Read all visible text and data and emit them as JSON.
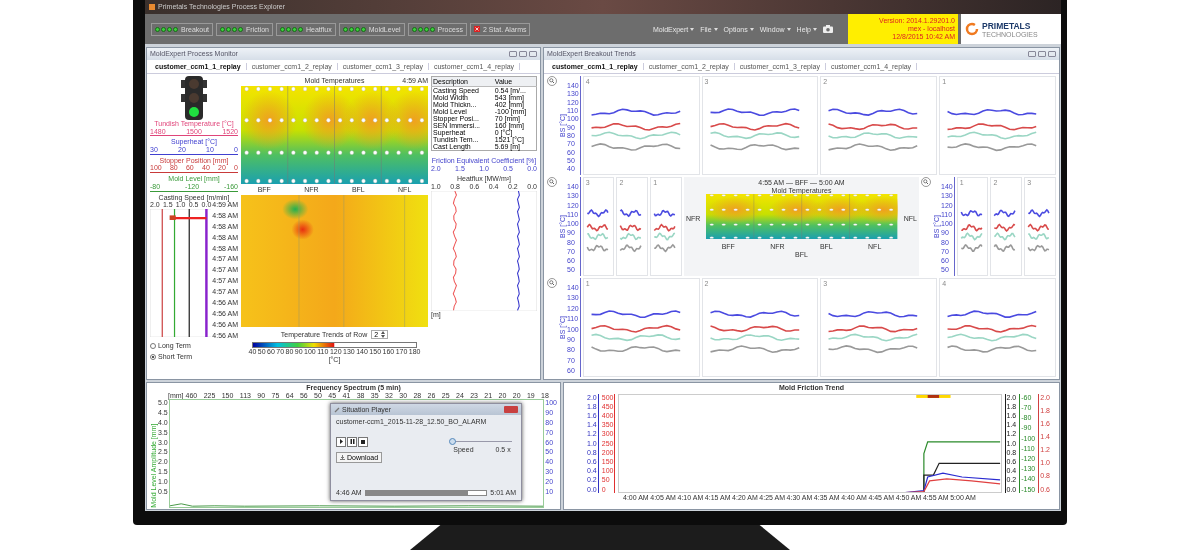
{
  "window": {
    "title": "Primetals Technologies Process Explorer"
  },
  "status_groups": [
    {
      "label": "Breakout"
    },
    {
      "label": "Friction"
    },
    {
      "label": "Heatflux"
    },
    {
      "label": "MoldLevel"
    },
    {
      "label": "Process"
    }
  ],
  "alarm": {
    "label": "2 Stat. Alarms"
  },
  "menu": [
    {
      "label": "MoldExpert"
    },
    {
      "label": "File"
    },
    {
      "label": "Options"
    },
    {
      "label": "Window"
    },
    {
      "label": "Help"
    }
  ],
  "info": {
    "version": "Version: 2014.1.29201.0",
    "host": "mex - localhost",
    "datetime": "12/8/2015 10:42 AM"
  },
  "logo": {
    "name": "PRIMETALS",
    "tagline": "TECHNOLOGIES"
  },
  "process_monitor": {
    "title": "MoldExpert Process Monitor",
    "tabs": [
      {
        "label": "customer_ccm1_1_replay",
        "selected": true
      },
      {
        "label": "customer_ccm1_2_replay",
        "selected": false
      },
      {
        "label": "customer_ccm1_3_replay",
        "selected": false
      },
      {
        "label": "customer_ccm1_4_replay",
        "selected": false
      }
    ],
    "traffic_light": {
      "lamps": [
        {
          "on": false
        },
        {
          "on": false
        },
        {
          "on": true
        }
      ]
    },
    "gauges": [
      {
        "title": "Tundish Temperature [°C]",
        "ticks": [
          "1480",
          "1500",
          "1520"
        ],
        "color": "#e0457a"
      },
      {
        "title": "Superheat [°C]",
        "ticks": [
          "30",
          "20",
          "10",
          "0"
        ],
        "color": "#4040d0"
      },
      {
        "title": "Stopper Position [mm]",
        "ticks": [
          "100",
          "80",
          "60",
          "40",
          "20",
          "0"
        ],
        "color": "#c83a3a"
      },
      {
        "title": "Mold Level [mm]",
        "ticks": [
          "-80",
          "-120",
          "-160"
        ],
        "color": "#3a9a3a"
      }
    ],
    "speed_chart": {
      "title": "Casting Speed [m/min]",
      "ticks": [
        "2.0",
        "1.5",
        "1.0",
        "0.5",
        "0.0"
      ],
      "times": [
        "4:59 AM",
        "4:58 AM",
        "4:58 AM",
        "4:58 AM",
        "4:58 AM",
        "4:57 AM",
        "4:57 AM",
        "4:57 AM",
        "4:57 AM",
        "4:56 AM",
        "4:56 AM",
        "4:56 AM",
        "4:56 AM"
      ]
    },
    "heatmap": {
      "title": "Mold Temperatures",
      "time": "4:59 AM",
      "columns": [
        "BFF",
        "NFR",
        "BFL",
        "NFL"
      ]
    },
    "row_selector": {
      "label": "Temperature Trends of Row",
      "value": "2"
    },
    "colorbar": {
      "ticks": [
        "40",
        "50",
        "60",
        "70",
        "80",
        "90",
        "100",
        "110",
        "120",
        "130",
        "140",
        "150",
        "160",
        "170",
        "180"
      ],
      "unit": "[°C]",
      "level": 0.5
    },
    "table": {
      "columns": [
        "Description",
        "Value"
      ],
      "rows": [
        [
          "Casting Speed",
          "0.54 [m/..."
        ],
        [
          "Mold Width",
          "543 [mm]"
        ],
        [
          "Mold Thickn...",
          "402 [mm]"
        ],
        [
          "Mold Level",
          "-100 [mm]"
        ],
        [
          "Stopper Posi...",
          "70 [mm]"
        ],
        [
          "SEN Immersi...",
          "160 [mm]"
        ],
        [
          "Superheat",
          "0 [°C]"
        ],
        [
          "Tundish Tem...",
          "1521 [°C]"
        ],
        [
          "Cast Length",
          "5.69 [m]"
        ]
      ]
    },
    "friction_chart": {
      "title": "Friction Equivalent Coefficient [%]",
      "ticks": [
        "2.0",
        "1.5",
        "1.0",
        "0.5",
        "0.0"
      ]
    },
    "heatflux_chart": {
      "title": "Heatflux [MW/m²]",
      "ticks": [
        "1.0",
        "0.8",
        "0.6",
        "0.4",
        "0.2",
        "0.0"
      ],
      "unit": "[m]"
    },
    "radios": [
      {
        "label": "Long Term",
        "selected": false
      },
      {
        "label": "Short Term",
        "selected": true
      }
    ]
  },
  "breakout_trends": {
    "title": "MoldExpert Breakout Trends",
    "tabs": [
      {
        "label": "customer_ccm1_1_replay",
        "selected": true
      },
      {
        "label": "customer_ccm1_2_replay",
        "selected": false
      },
      {
        "label": "customer_ccm1_3_replay",
        "selected": false
      },
      {
        "label": "customer_ccm1_4_replay",
        "selected": false
      }
    ],
    "top_row": {
      "axis": {
        "label": "BS [°C]",
        "ticks": [
          "140",
          "130",
          "120",
          "110",
          "100",
          "90",
          "80",
          "70",
          "60",
          "50",
          "40"
        ]
      },
      "charts": [
        "4",
        "3",
        "2",
        "1"
      ]
    },
    "middle_row": {
      "left": {
        "axis": {
          "label": "BS [°C]",
          "ticks": [
            "140",
            "130",
            "120",
            "110",
            "100",
            "90",
            "80",
            "70",
            "60",
            "50"
          ]
        },
        "charts": [
          "3",
          "2",
          "1"
        ]
      },
      "center": {
        "time_range": "4:55 AM — BFF — 5:00 AM",
        "title": "Mold Temperatures",
        "left_label": "NFR",
        "right_label": "NFL",
        "columns": [
          "BFF",
          "NFR",
          "BFL",
          "NFL"
        ],
        "bottom_label": "BFL"
      },
      "right": {
        "axis": {
          "label": "BS [°C]",
          "ticks": [
            "140",
            "130",
            "120",
            "110",
            "100",
            "90",
            "80",
            "70",
            "60",
            "50"
          ]
        },
        "charts": [
          "1",
          "2",
          "3"
        ]
      }
    },
    "bottom_row": {
      "axis": {
        "label": "BS [°C]",
        "ticks": [
          "140",
          "130",
          "120",
          "110",
          "100",
          "90",
          "80",
          "70",
          "60"
        ]
      },
      "charts": [
        "1",
        "2",
        "3",
        "4"
      ]
    }
  },
  "frequency_spectrum": {
    "title": "Frequency Spectrum (5 min)",
    "x_unit": "[mm]",
    "xticks": [
      "460",
      "225",
      "150",
      "113",
      "90",
      "75",
      "64",
      "56",
      "50",
      "45",
      "41",
      "38",
      "35",
      "32",
      "30",
      "28",
      "26",
      "25",
      "24",
      "23",
      "21",
      "20",
      "20",
      "19",
      "18"
    ],
    "yticks": [
      "5.0",
      "4.5",
      "4.0",
      "3.5",
      "3.0",
      "2.5",
      "2.0",
      "1.5",
      "1.0",
      "0.5"
    ],
    "ylabel": "Mold Level Amplitude [mm]",
    "right_ticks": [
      "100",
      "90",
      "80",
      "70",
      "60",
      "50",
      "40",
      "30",
      "20",
      "10"
    ]
  },
  "situation_player": {
    "title": "Situation Player",
    "file": "customer-ccm1_2015-11-28_12.50_BO_ALARM",
    "download": "Download",
    "speed_label": "Speed",
    "speed_value": "0.5 x",
    "speed": {
      "level": 0
    },
    "start": "4:46 AM",
    "end": "5:01 AM",
    "progress": {
      "level": 0.85
    }
  },
  "friction_trend": {
    "title": "Mold Friction Trend",
    "left_axes": [
      {
        "ticks": [
          "2.0",
          "1.8",
          "1.6",
          "1.4",
          "1.2",
          "1.0",
          "0.8",
          "0.6",
          "0.4",
          "0.2",
          "0.0"
        ],
        "color": "#3030c0"
      },
      {
        "ticks": [
          "500",
          "450",
          "400",
          "350",
          "300",
          "250",
          "200",
          "150",
          "100",
          "50",
          "0"
        ],
        "color": "#e03030"
      }
    ],
    "right_axes": [
      {
        "ticks": [
          "2.0",
          "1.8",
          "1.6",
          "1.4",
          "1.2",
          "1.0",
          "0.8",
          "0.6",
          "0.4",
          "0.2",
          "0.0"
        ],
        "color": "#202020"
      },
      {
        "ticks": [
          "-60",
          "-70",
          "-80",
          "-90",
          "-100",
          "-110",
          "-120",
          "-130",
          "-140",
          "-150"
        ],
        "color": "#2a8a2a"
      },
      {
        "ticks": [
          "2.0",
          "1.8",
          "1.6",
          "1.4",
          "1.2",
          "1.0",
          "0.8",
          "0.6"
        ],
        "color": "#d04040"
      }
    ],
    "xticks": [
      "4:00 AM",
      "4:05 AM",
      "4:10 AM",
      "4:15 AM",
      "4:20 AM",
      "4:25 AM",
      "4:30 AM",
      "4:35 AM",
      "4:40 AM",
      "4:45 AM",
      "4:50 AM",
      "4:55 AM",
      "5:00 AM"
    ]
  }
}
